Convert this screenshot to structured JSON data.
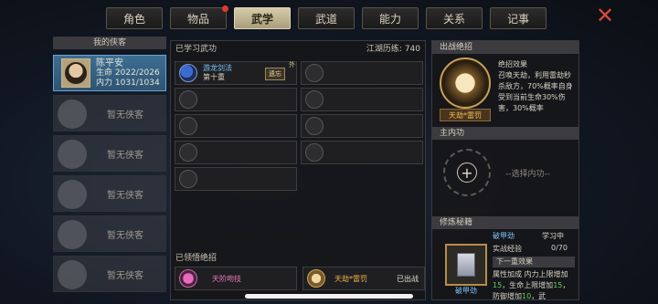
{
  "tabs": [
    {
      "label": "角色",
      "active": false
    },
    {
      "label": "物品",
      "active": false,
      "has_notice": true
    },
    {
      "label": "武学",
      "active": true
    },
    {
      "label": "武道",
      "active": false
    },
    {
      "label": "能力",
      "active": false
    },
    {
      "label": "关系",
      "active": false
    },
    {
      "label": "记事",
      "active": false
    }
  ],
  "close_icon": "✕",
  "my_heroes": {
    "title": "我的侠客",
    "hero": {
      "name": "陈平安",
      "hp_label": "生命",
      "hp": "2022/2026",
      "mp_label": "内力",
      "mp": "1031/1034"
    },
    "empty_label": "暂无侠客"
  },
  "learned": {
    "title": "已学习武功",
    "xp_label": "江湖历练",
    "xp_value": "740",
    "skill": {
      "name": "游龙剑法",
      "level": "第十重",
      "forget_label": "遗忘",
      "badge": "外"
    }
  },
  "comprehended": {
    "title": "已领悟绝招",
    "items": [
      {
        "name": "天阶吻技",
        "status": ""
      },
      {
        "name": "天劫*雷罚",
        "status": "已出战"
      }
    ]
  },
  "right": {
    "ult_title": "出战绝招",
    "ult_name": "天劫*雷罚",
    "ult_effect_label": "绝招效果",
    "ult_desc": "召唤天劫，利用雷劫秒杀敌方，70%概率自身受到当前生命30%伤害，30%概率",
    "main_title": "主内功",
    "main_placeholder": "--选择内功--",
    "train_title": "修炼秘籍",
    "book_name": "破甲劲",
    "book_status": "学习中",
    "exp_label": "实战经验",
    "exp_value": "0/70",
    "next_label": "下一重效果",
    "effect_prefix": "属性加成",
    "effect_1": "内力上限增加",
    "val_1": "15",
    "effect_2": "，生命上限增加",
    "val_2": "15",
    "effect_3": "，防御增加",
    "val_3": "10",
    "effect_4": "，武"
  }
}
